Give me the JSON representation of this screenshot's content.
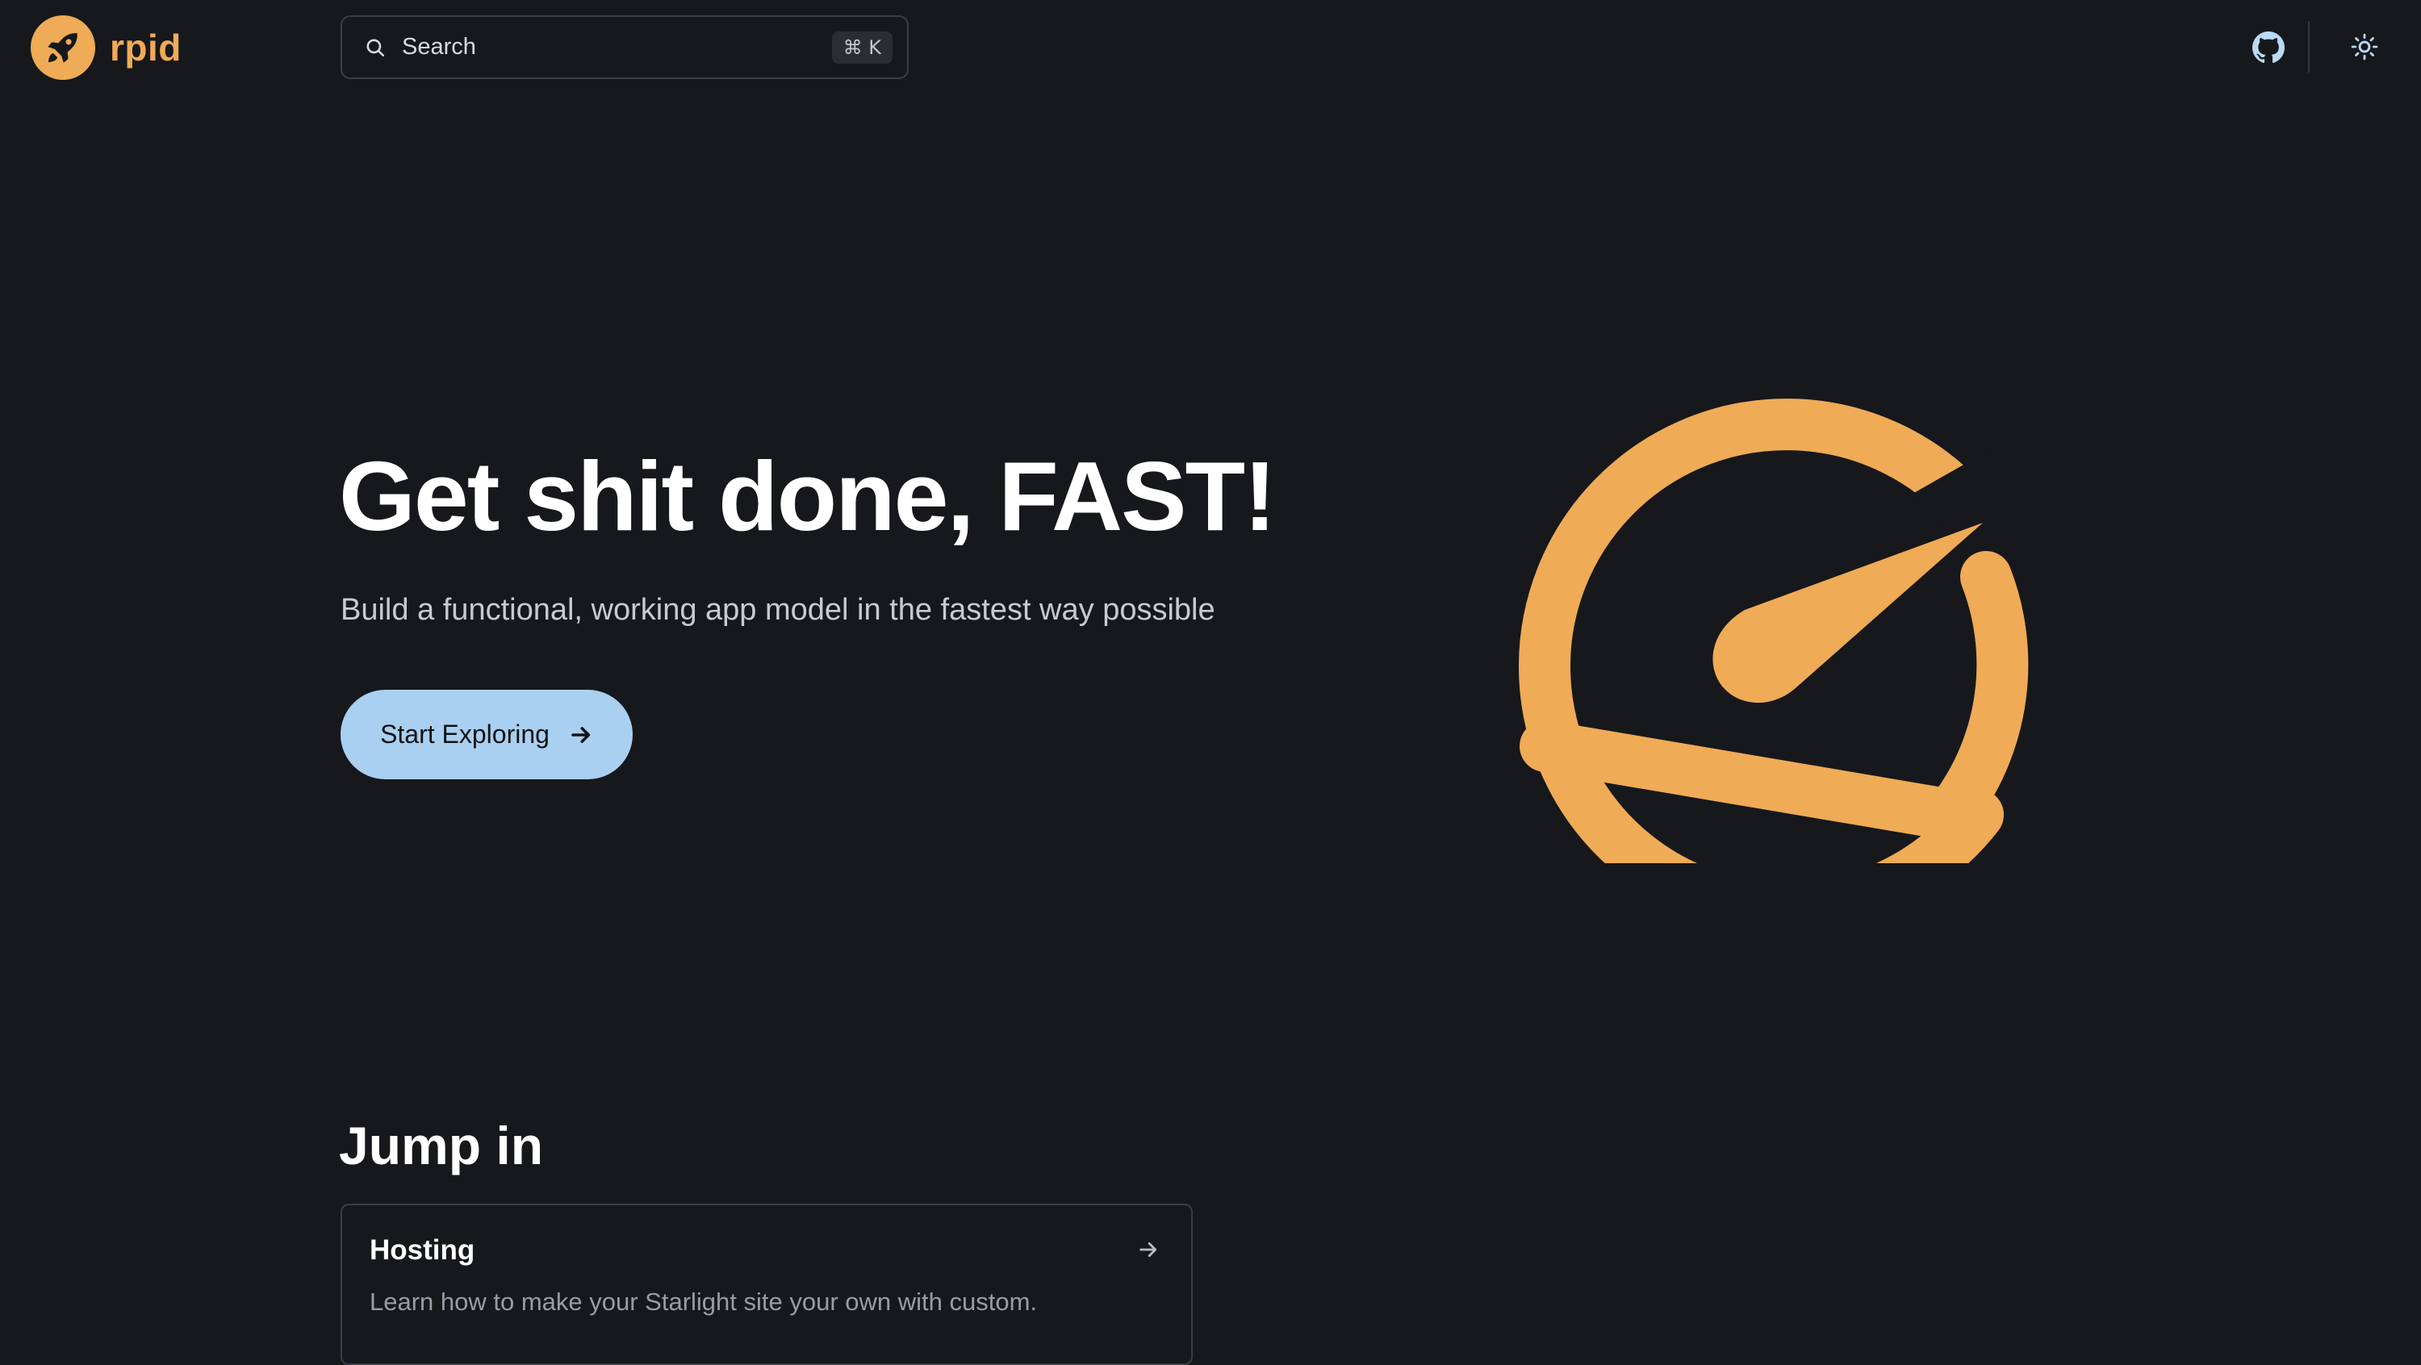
{
  "header": {
    "brand_name": "rpid",
    "brand_icon": "rocket-icon",
    "search": {
      "label": "Search",
      "shortcut": "⌘ K",
      "icon": "search-icon"
    },
    "github_icon": "github-icon",
    "theme_icon": "sun-icon"
  },
  "hero": {
    "title": "Get shit done, FAST!",
    "tagline": "Build a functional, working app model in the fastest way possible",
    "cta_label": "Start Exploring",
    "cta_icon": "arrow-right-icon",
    "image_icon": "speedometer-icon"
  },
  "jump_in": {
    "heading": "Jump in",
    "cards": [
      {
        "title": "Hosting",
        "description": "Learn how to make your Starlight site your own with custom.",
        "icon": "arrow-right-icon"
      }
    ]
  },
  "colors": {
    "background": "#17181c",
    "accent": "#efab56",
    "cta_background": "#a9d0f0",
    "muted_text": "#989ca6"
  }
}
